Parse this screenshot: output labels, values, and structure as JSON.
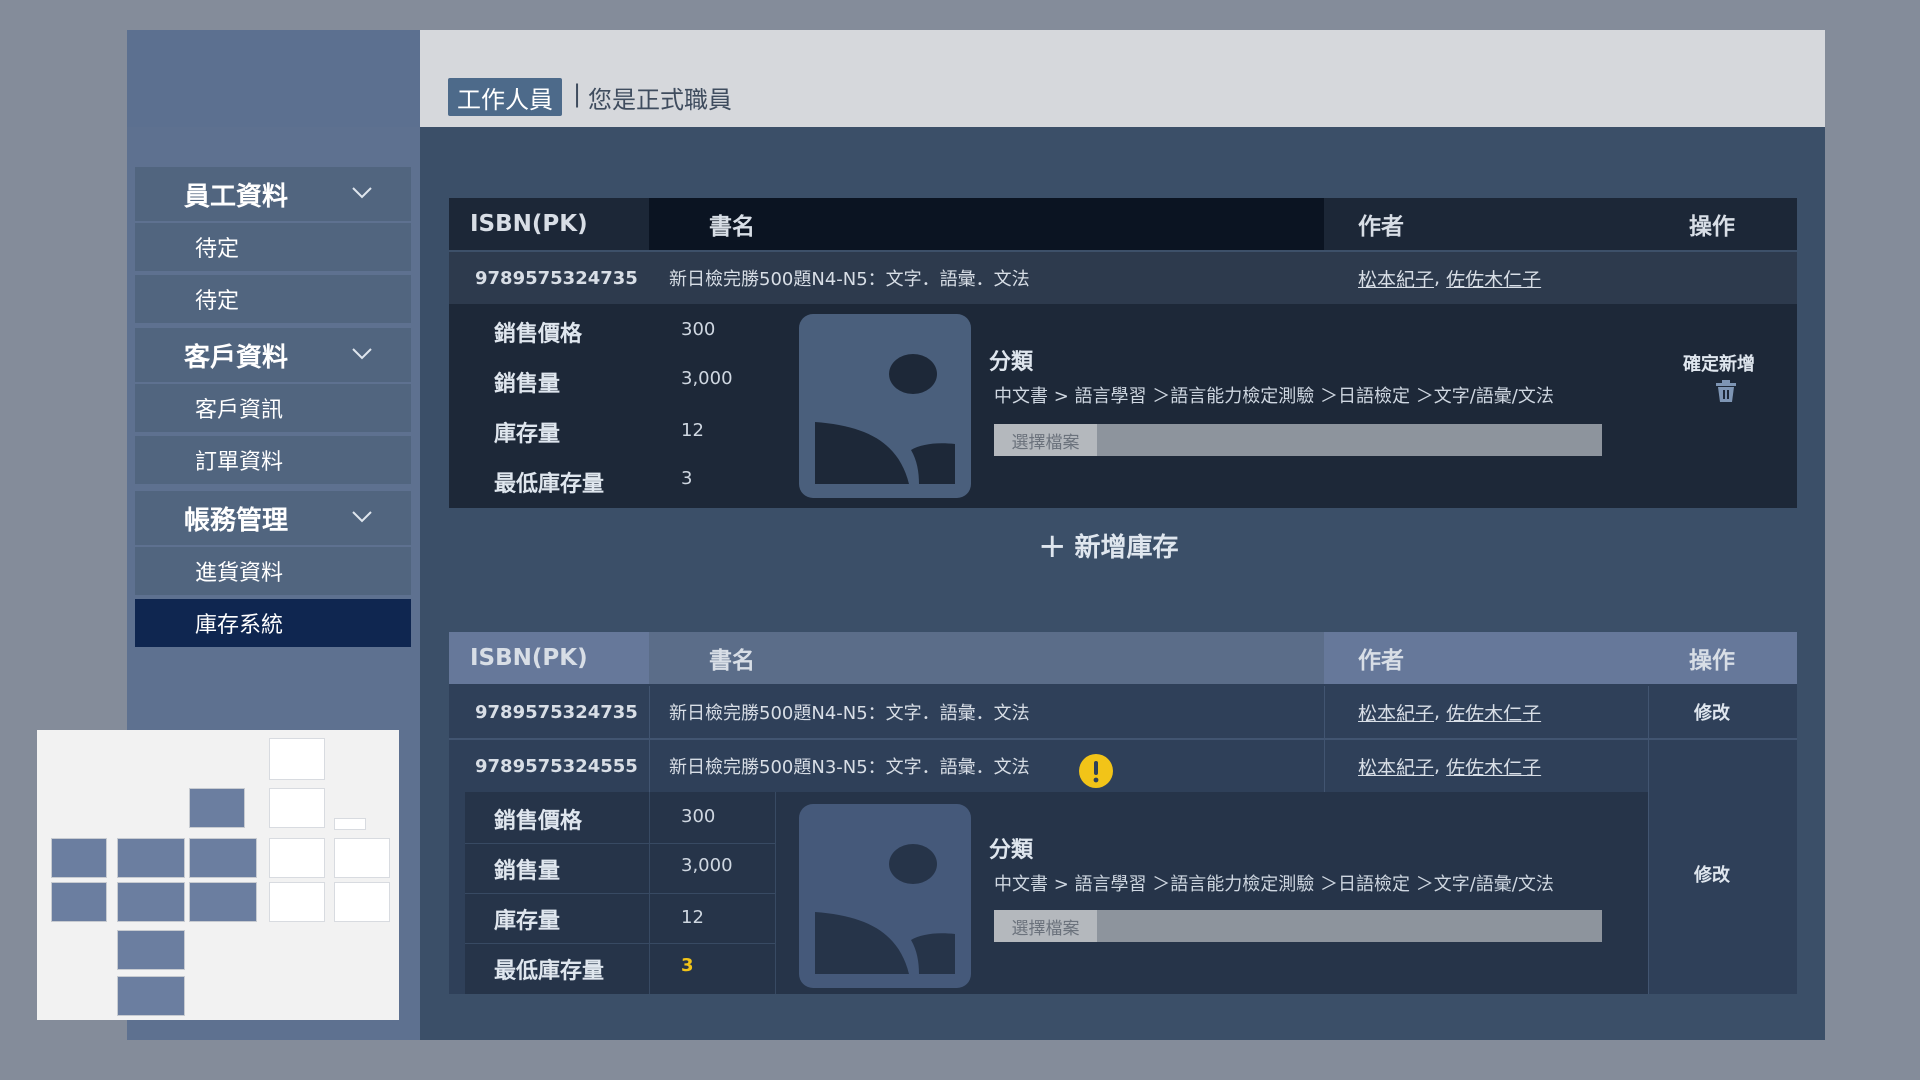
{
  "header": {
    "role_badge": "工作人員",
    "separator": "|",
    "role_text": "您是正式職員"
  },
  "sidebar": {
    "groups": [
      {
        "label": "員工資料",
        "items": [
          "待定",
          "待定"
        ]
      },
      {
        "label": "客戶資料",
        "items": [
          "客戶資訊",
          "訂單資料"
        ]
      },
      {
        "label": "帳務管理",
        "items": [
          "進貨資料",
          "庫存系統"
        ]
      }
    ],
    "active_item": "庫存系統"
  },
  "table_headers": {
    "isbn": "ISBN(PK)",
    "title": "書名",
    "author": "作者",
    "actions": "操作"
  },
  "new_entry": {
    "isbn": "9789575324735",
    "title": "新日檢完勝500題N4-N5：文字．語彙．文法",
    "authors": [
      "松本紀子",
      "佐佐木仁子"
    ],
    "author_sep": ",",
    "fields": [
      {
        "label": "銷售價格",
        "value": "300"
      },
      {
        "label": "銷售量",
        "value": "3,000"
      },
      {
        "label": "庫存量",
        "value": "12"
      },
      {
        "label": "最低庫存量",
        "value": "3"
      }
    ],
    "category_title": "分類",
    "category_path": "中文書 > 語言學習 ＞語言能力檢定測驗 ＞日語檢定 ＞文字/語彙/文法",
    "file_button": "選擇檔案",
    "confirm_label": "確定新增",
    "delete_icon": "trash-icon"
  },
  "add_stock_label": "新增庫存",
  "inventory": [
    {
      "isbn": "9789575324735",
      "title": "新日檢完勝500題N4-N5：文字．語彙．文法",
      "authors": [
        "松本紀子",
        "佐佐木仁子"
      ],
      "action": "修改"
    },
    {
      "isbn": "9789575324555",
      "title": "新日檢完勝500題N3-N5：文字．語彙．文法",
      "authors": [
        "松本紀子",
        "佐佐木仁子"
      ],
      "warning_icon": "exclamation-icon",
      "action": "修改",
      "fields": [
        {
          "label": "銷售價格",
          "value": "300"
        },
        {
          "label": "銷售量",
          "value": "3,000"
        },
        {
          "label": "庫存量",
          "value": "12"
        },
        {
          "label": "最低庫存量",
          "value": "3"
        }
      ],
      "category_title": "分類",
      "category_path": "中文書 > 語言學習 ＞語言能力檢定測驗 ＞日語檢定 ＞文字/語彙/文法",
      "file_button": "選擇檔案"
    }
  ],
  "colors": {
    "sidebar_bg": "#5e7190",
    "content_bg": "#3b4f68",
    "active_item": "#0f2650",
    "warning": "#f2c418",
    "low_stock_value": "#f2c418"
  }
}
